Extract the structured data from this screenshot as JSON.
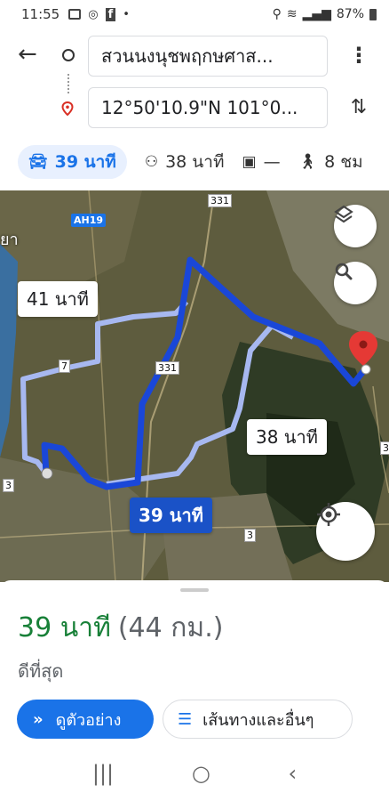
{
  "status": {
    "time": "11:55",
    "left_icons": [
      "image-icon",
      "cast-icon",
      "facebook-icon",
      "dot-icon"
    ],
    "battery": "87%"
  },
  "route": {
    "origin": "สวนนงนุชพฤกษศาส...",
    "destination": "12°50'10.9\"N 101°0..."
  },
  "modes": [
    {
      "icon": "car-icon",
      "label": "39 นาที",
      "active": true
    },
    {
      "icon": "motorcycle-icon",
      "label": "38 นาที",
      "active": false
    },
    {
      "icon": "transit-icon",
      "label": "—",
      "active": false
    },
    {
      "icon": "walk-icon",
      "label": "8 ชม",
      "active": false
    }
  ],
  "map": {
    "bubbles": {
      "alt1": "41 นาที",
      "alt2": "38 นาที",
      "primary": "39 นาที"
    },
    "road_labels": [
      "331",
      "7",
      "331",
      "3",
      "3",
      "3"
    ],
    "ah_label": "AH19",
    "place_label": "ยา",
    "colors": {
      "primary_route": "#1a47d8",
      "alt_route": "#a7b8f0",
      "pin": "#e53935"
    }
  },
  "sheet": {
    "duration": "39 นาที",
    "distance": "(44 กม.)",
    "note": "ดีที่สุด",
    "preview_label": "ดูตัวอย่าง",
    "steps_label": "เส้นทางและอื่นๆ"
  },
  "navbar": [
    "recents-icon",
    "home-icon",
    "back-icon"
  ]
}
